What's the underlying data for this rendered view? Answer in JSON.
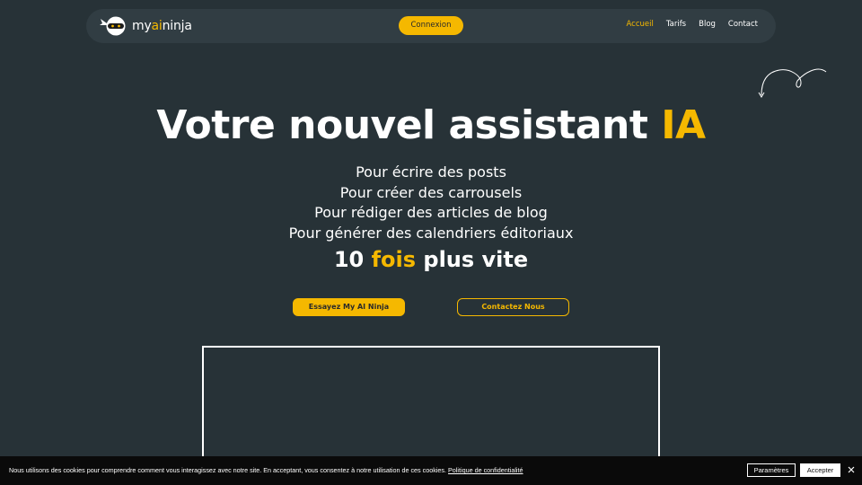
{
  "nav": {
    "logo_prefix": "my",
    "logo_accent": "ai",
    "logo_suffix": "ninja",
    "connexion_label": "Connexion",
    "links": [
      {
        "label": "Accueil",
        "active": true
      },
      {
        "label": "Tarifs",
        "active": false
      },
      {
        "label": "Blog",
        "active": false
      },
      {
        "label": "Contact",
        "active": false
      }
    ]
  },
  "hero": {
    "title_main": "Votre nouvel assistant ",
    "title_accent": "IA",
    "lines": [
      "Pour écrire des posts",
      "Pour créer des carrousels",
      "Pour rédiger des articles de blog",
      "Pour générer des calendriers éditoriaux"
    ],
    "speed_prefix": "10 ",
    "speed_accent": "fois",
    "speed_suffix": " plus vite",
    "cta_primary": "Essayez My AI Ninja",
    "cta_secondary": "Contactez Nous"
  },
  "cookie": {
    "text": "Nous utilisons des cookies pour comprendre comment vous interagissez avec notre site. En acceptant, vous consentez à notre utilisation de ces cookies. ",
    "policy_link": "Politique de confidentialité",
    "params_label": "Paramètres",
    "accept_label": "Accepter"
  },
  "colors": {
    "background": "#273237",
    "accent": "#f5b800",
    "navbar": "#313d43",
    "cookie_bar": "#0a0a0a"
  },
  "icons": [
    "ninja-logo-icon",
    "decorative-squiggle-arrow",
    "close-icon"
  ]
}
